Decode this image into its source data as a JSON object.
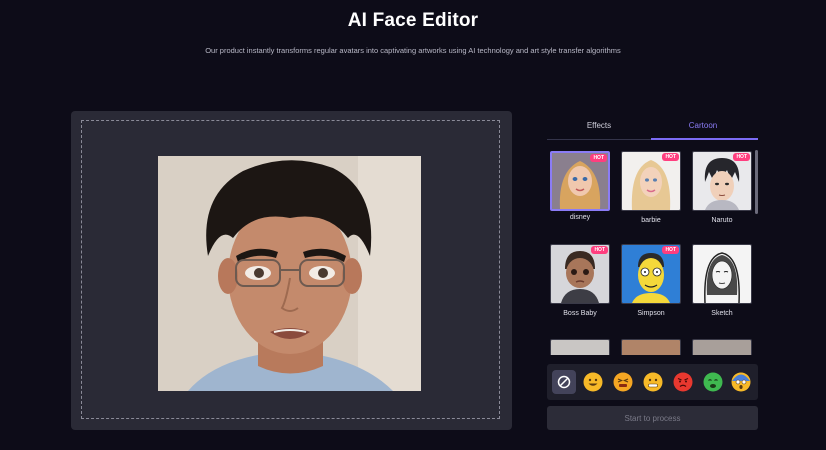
{
  "header": {
    "title": "AI Face Editor",
    "subtitle": "Our product instantly transforms regular avatars into captivating artworks using AI technology and art style transfer algorithms"
  },
  "tabs": [
    {
      "label": "Effects",
      "active": false
    },
    {
      "label": "Cartoon",
      "active": true
    }
  ],
  "styles": [
    {
      "label": "disney",
      "hot": true,
      "selected": true
    },
    {
      "label": "barbie",
      "hot": true,
      "selected": false
    },
    {
      "label": "Naruto",
      "hot": true,
      "selected": false
    },
    {
      "label": "Boss Baby",
      "hot": true,
      "selected": false
    },
    {
      "label": "Simpson",
      "hot": true,
      "selected": false
    },
    {
      "label": "Sketch",
      "hot": false,
      "selected": false
    }
  ],
  "hot_badge": "HOT",
  "emoji_bar": {
    "none_icon": "ban-icon",
    "emojis": [
      "grinning-face",
      "angry-squint-face",
      "grimacing-face",
      "angry-red-face",
      "crying-green-face",
      "shocked-face"
    ]
  },
  "process_button": "Start to process",
  "colors": {
    "accent": "#7c6cf5",
    "background": "#0d0c18",
    "panel": "#2a2a36",
    "hot_badge": "#ff3e7f"
  }
}
